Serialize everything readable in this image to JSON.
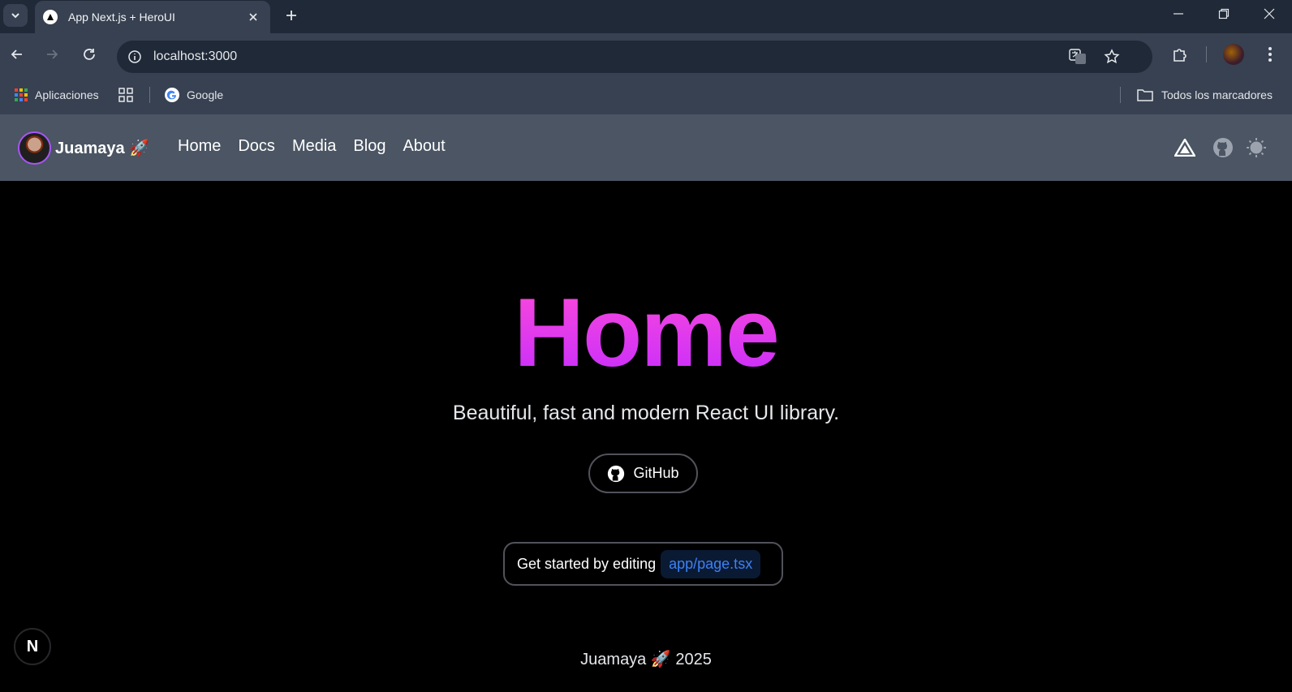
{
  "browser": {
    "tab_title": "App Next.js + HeroUI",
    "url": "localhost:3000",
    "bookmarks": {
      "apps": "Aplicaciones",
      "google": "Google",
      "all": "Todos los marcadores"
    }
  },
  "site": {
    "brand": "Juamaya 🚀",
    "nav": [
      "Home",
      "Docs",
      "Media",
      "Blog",
      "About"
    ]
  },
  "hero": {
    "title": "Home",
    "subtitle": "Beautiful, fast and modern React UI library.",
    "github_label": "GitHub",
    "snippet_text": "Get started by editing",
    "snippet_code": "app/page.tsx"
  },
  "footer": {
    "text": "Juamaya 🚀 2025"
  },
  "next_badge": "N",
  "colors": {
    "accent_gradient": [
      "#ff4bd8",
      "#c32bff"
    ],
    "code_text": "#3b82f6"
  }
}
